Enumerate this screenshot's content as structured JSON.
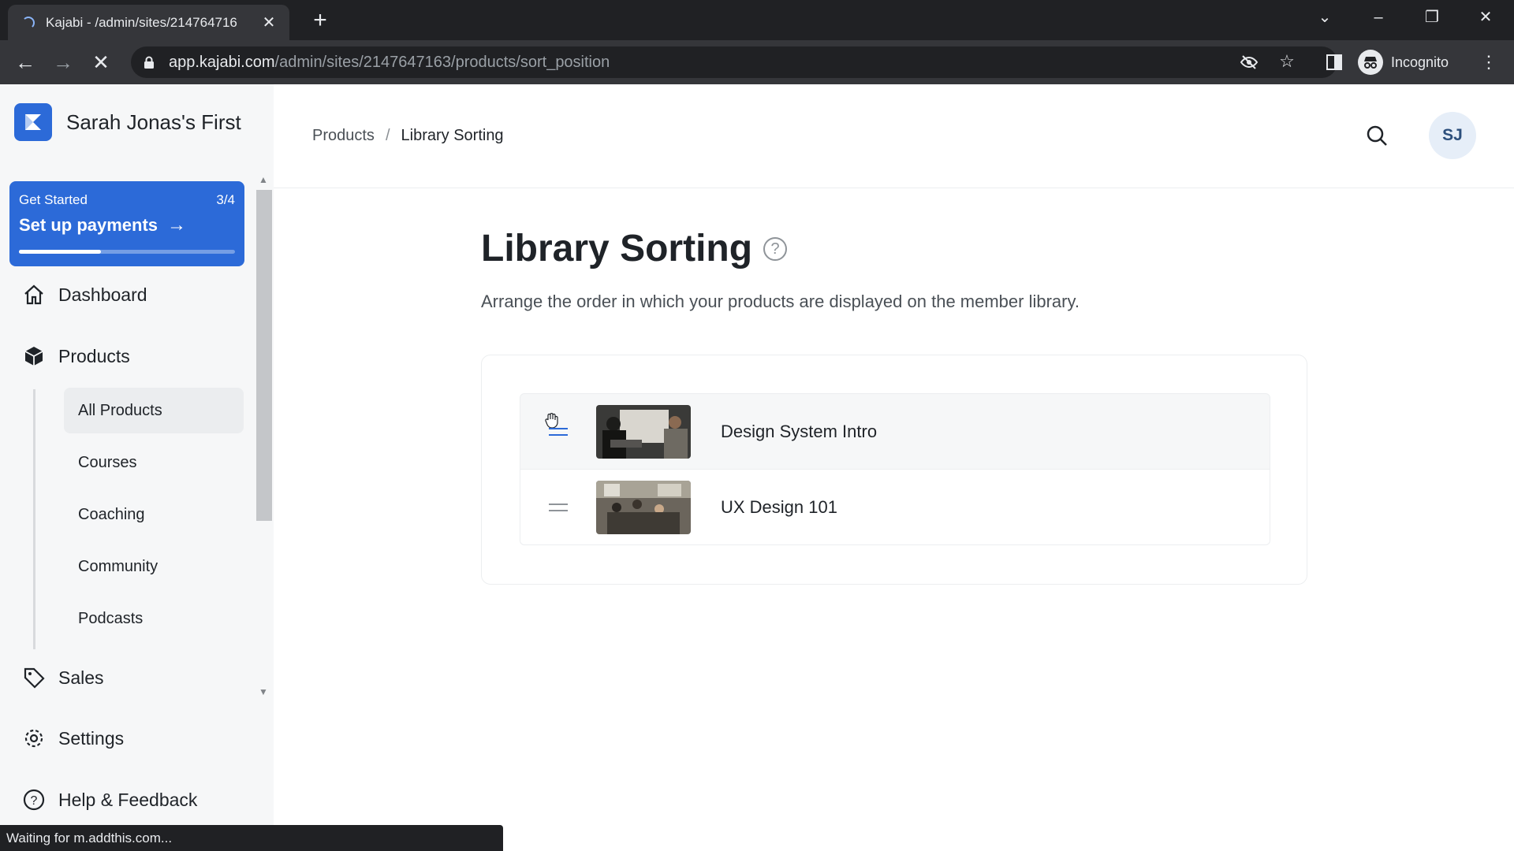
{
  "browser": {
    "tab_title": "Kajabi - /admin/sites/214764716",
    "url_host": "app.kajabi.com",
    "url_path": "/admin/sites/2147647163/products/sort_position",
    "profile_label": "Incognito",
    "status_text": "Waiting for m.addthis.com..."
  },
  "sidebar": {
    "site_name": "Sarah Jonas's First",
    "get_started": {
      "label": "Get Started",
      "progress_text": "3/4",
      "cta": "Set up payments",
      "progress": 0.38
    },
    "nav": {
      "dashboard": "Dashboard",
      "products": "Products",
      "sales": "Sales",
      "settings": "Settings",
      "help": "Help & Feedback"
    },
    "products_sub": [
      "All Products",
      "Courses",
      "Coaching",
      "Community",
      "Podcasts"
    ]
  },
  "header": {
    "breadcrumb_parent": "Products",
    "breadcrumb_sep": "/",
    "breadcrumb_current": "Library Sorting",
    "avatar_initials": "SJ"
  },
  "main": {
    "title": "Library Sorting",
    "help_glyph": "?",
    "description": "Arrange the order in which your products are displayed on the member library.",
    "products": [
      {
        "title": "Design System Intro"
      },
      {
        "title": "UX Design 101"
      }
    ]
  },
  "colors": {
    "brand": "#2c6ad8",
    "chrome_dark": "#202124",
    "sidebar_bg": "#f6f7f8"
  }
}
